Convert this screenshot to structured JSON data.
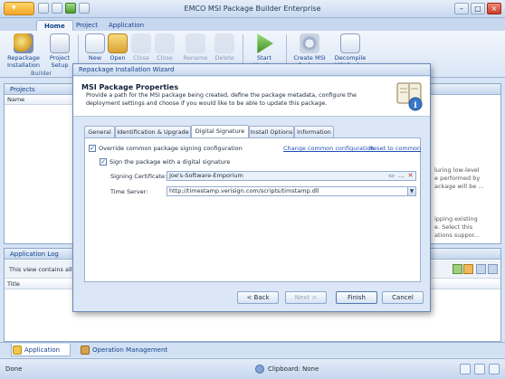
{
  "window": {
    "title": "EMCO MSI Package Builder Enterprise"
  },
  "ribbon": {
    "tabs": [
      "Home",
      "Project",
      "Application"
    ],
    "buttons": {
      "repackage": "Repackage Installation",
      "project_setup": "Project Setup",
      "new": "New",
      "open": "Open",
      "close1": "Close",
      "close2": "Close",
      "rename": "Rename",
      "delete": "Delete",
      "start": "Start Monit...",
      "create_msi": "Create MSI Packa...",
      "decompile": "Decompile MSI Pack..."
    },
    "group_builder": "Builder"
  },
  "projects_pane": {
    "title": "Projects",
    "column": "Name"
  },
  "log_pane": {
    "title": "Application Log",
    "message": "This view contains all o",
    "column": "Title"
  },
  "background_text": {
    "line1": "luring low-level",
    "line2": "e performed by",
    "line3": "ackage will be ...",
    "line4": "ipping existing",
    "line5": "e. Select this",
    "line6": "ations suppor..."
  },
  "bottom_tabs": [
    "Application Log",
    "Operation Management"
  ],
  "status": {
    "left": "Done",
    "clipboard": "Clipboard: None"
  },
  "dialog": {
    "title": "Repackage Installation Wizard",
    "header_title": "MSI Package Properties",
    "header_desc": "Provide a path for the MSI package being created, define the package metadata, configure the deployment settings and choose if you would like to be able to update this package.",
    "tabs": [
      "General",
      "Identification & Upgrade",
      "Digital Signature",
      "Install Options",
      "Information"
    ],
    "override_label": "Override common package signing configuration",
    "change_link": "Change common configuration",
    "reset_link": "Reset to common",
    "sign_label": "Sign the package with a digital signature",
    "cert_label": "Signing Certificate:",
    "cert_value": "Joe's-Software-Emporium",
    "time_label": "Time Server:",
    "time_value": "http://timestamp.verisign.com/scripts/timstamp.dll",
    "buttons": {
      "back": "< Back",
      "next": "Next >",
      "finish": "Finish",
      "cancel": "Cancel"
    }
  }
}
